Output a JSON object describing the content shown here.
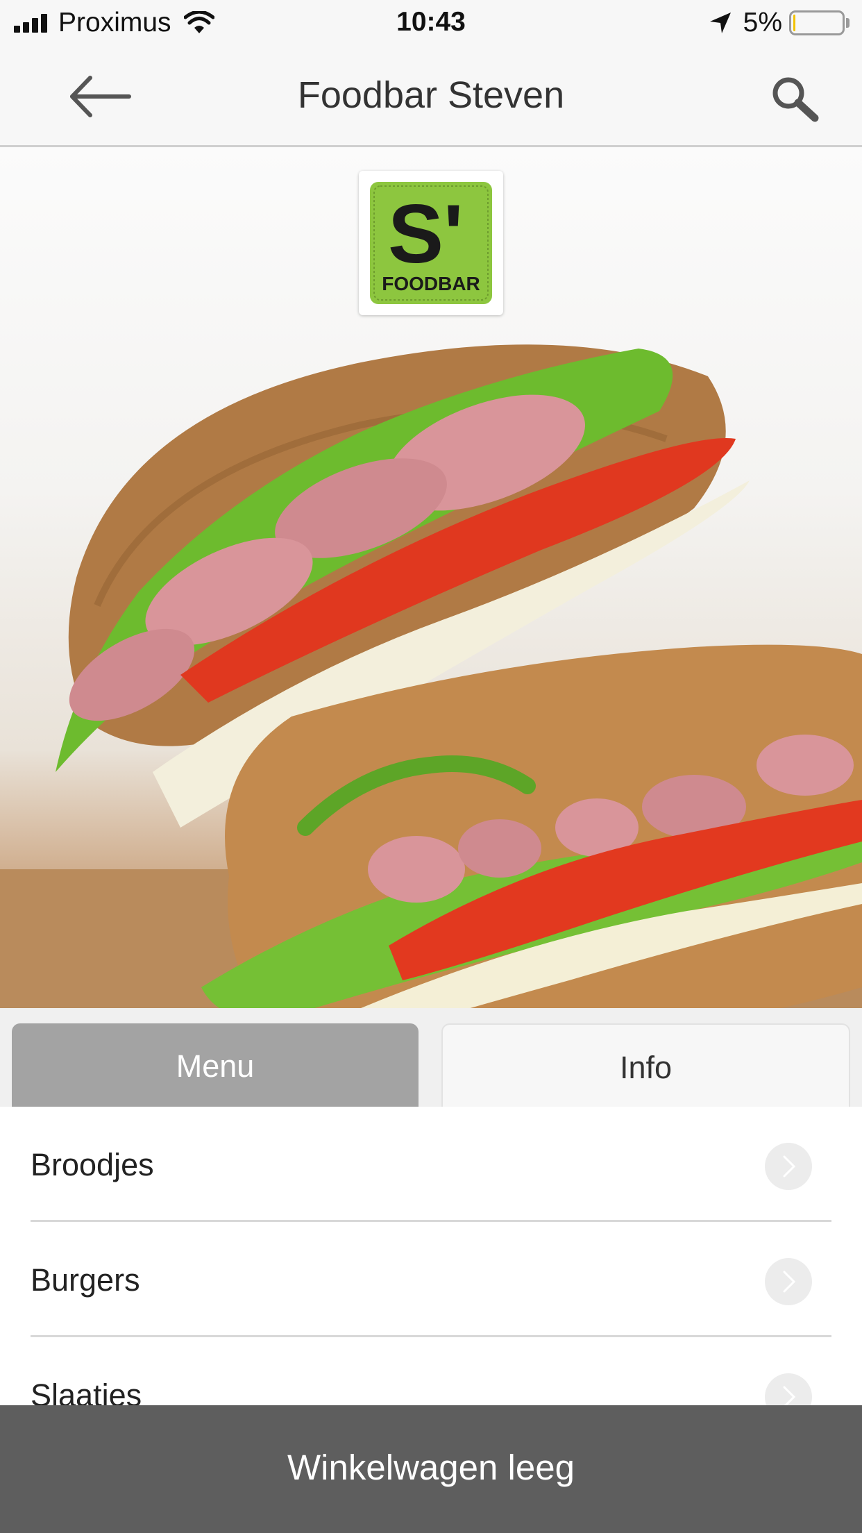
{
  "status_bar": {
    "carrier": "Proximus",
    "time": "10:43",
    "battery_percent": "5%",
    "battery_level": 0.05,
    "icons": [
      "signal-icon",
      "wifi-icon",
      "location-arrow-icon",
      "battery-icon"
    ]
  },
  "nav": {
    "title": "Foodbar Steven",
    "back_icon": "arrow-left-icon",
    "search_icon": "search-icon"
  },
  "hero": {
    "logo_text": "S'",
    "logo_subtext": "FOODBAR",
    "logo_colors": {
      "background": "#8dc63f",
      "letter": "#1a1a1a",
      "accent": "#e4202a"
    }
  },
  "tabs": [
    {
      "label": "Menu",
      "selected": true
    },
    {
      "label": "Info",
      "selected": false
    }
  ],
  "menu_items": [
    {
      "label": "Broodjes"
    },
    {
      "label": "Burgers"
    },
    {
      "label": "Slaatjes"
    }
  ],
  "cart": {
    "label": "Winkelwagen leeg"
  },
  "colors": {
    "tab_selected": "#a3a3a3",
    "cart_bar": "#5e5e5e",
    "bar_background": "#f7f7f7"
  }
}
